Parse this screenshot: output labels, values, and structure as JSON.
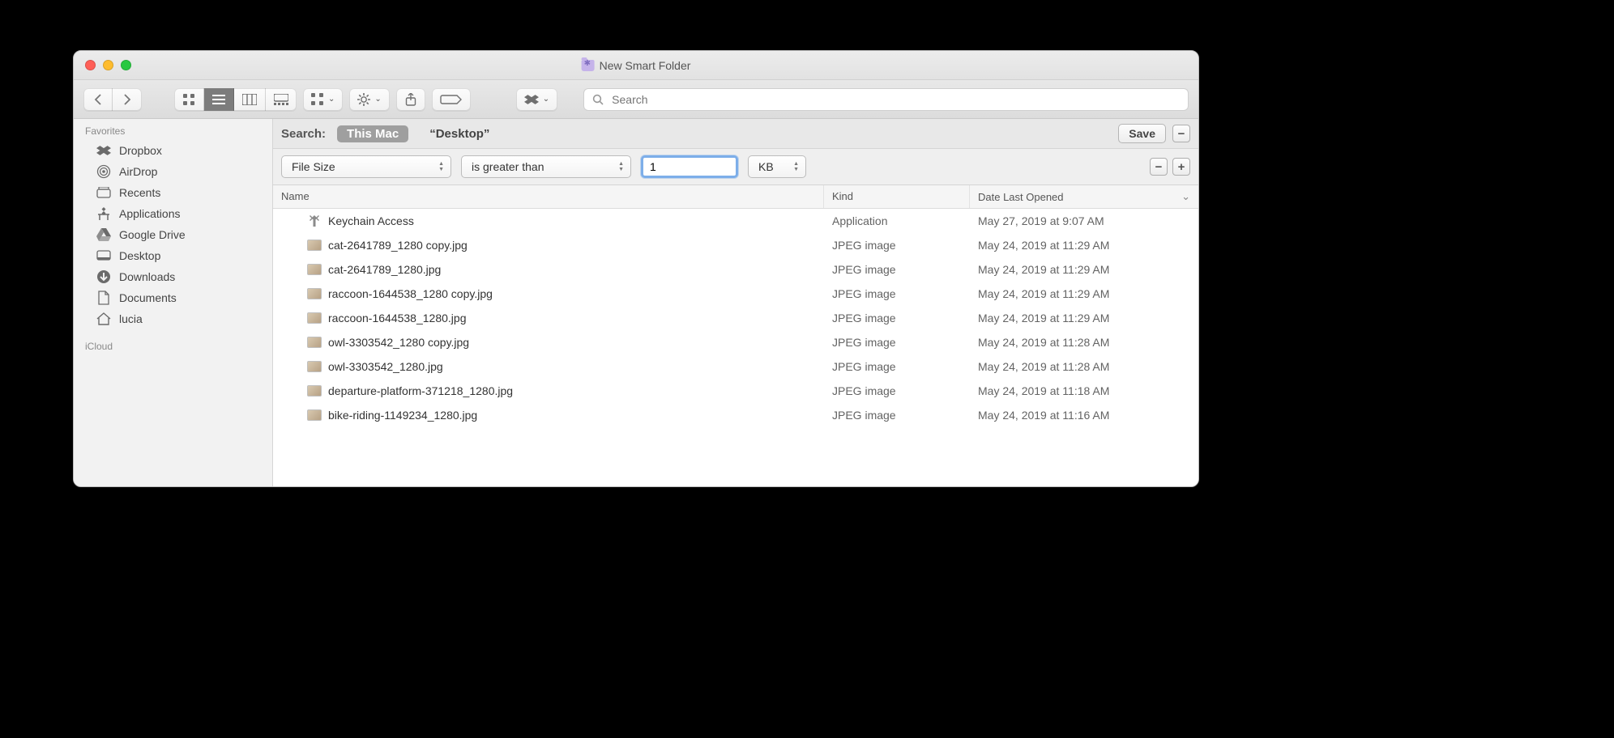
{
  "window": {
    "title": "New Smart Folder"
  },
  "toolbar": {
    "search_placeholder": "Search"
  },
  "sidebar": {
    "sections": [
      {
        "label": "Favorites",
        "items": [
          {
            "icon": "dropbox-icon",
            "label": "Dropbox"
          },
          {
            "icon": "airdrop-icon",
            "label": "AirDrop"
          },
          {
            "icon": "recents-icon",
            "label": "Recents"
          },
          {
            "icon": "applications-icon",
            "label": "Applications"
          },
          {
            "icon": "google-drive-icon",
            "label": "Google Drive"
          },
          {
            "icon": "desktop-icon",
            "label": "Desktop"
          },
          {
            "icon": "downloads-icon",
            "label": "Downloads"
          },
          {
            "icon": "documents-icon",
            "label": "Documents"
          },
          {
            "icon": "home-icon",
            "label": "lucia"
          }
        ]
      },
      {
        "label": "iCloud",
        "items": []
      }
    ]
  },
  "scope": {
    "label": "Search:",
    "options": [
      {
        "label": "This Mac",
        "selected": true
      },
      {
        "label": "“Desktop”",
        "selected": false
      }
    ],
    "save_label": "Save"
  },
  "criteria": {
    "attribute": "File Size",
    "comparison": "is greater than",
    "value": "1",
    "unit": "KB"
  },
  "table": {
    "columns": [
      {
        "label": "Name"
      },
      {
        "label": "Kind"
      },
      {
        "label": "Date Last Opened"
      }
    ],
    "rows": [
      {
        "icon": "app",
        "name": "Keychain Access",
        "kind": "Application",
        "date": "May 27, 2019 at 9:07 AM"
      },
      {
        "icon": "img",
        "name": "cat-2641789_1280 copy.jpg",
        "kind": "JPEG image",
        "date": "May 24, 2019 at 11:29 AM"
      },
      {
        "icon": "img",
        "name": "cat-2641789_1280.jpg",
        "kind": "JPEG image",
        "date": "May 24, 2019 at 11:29 AM"
      },
      {
        "icon": "img",
        "name": "raccoon-1644538_1280 copy.jpg",
        "kind": "JPEG image",
        "date": "May 24, 2019 at 11:29 AM"
      },
      {
        "icon": "img",
        "name": "raccoon-1644538_1280.jpg",
        "kind": "JPEG image",
        "date": "May 24, 2019 at 11:29 AM"
      },
      {
        "icon": "img",
        "name": "owl-3303542_1280 copy.jpg",
        "kind": "JPEG image",
        "date": "May 24, 2019 at 11:28 AM"
      },
      {
        "icon": "img",
        "name": "owl-3303542_1280.jpg",
        "kind": "JPEG image",
        "date": "May 24, 2019 at 11:28 AM"
      },
      {
        "icon": "img",
        "name": "departure-platform-371218_1280.jpg",
        "kind": "JPEG image",
        "date": "May 24, 2019 at 11:18 AM"
      },
      {
        "icon": "img",
        "name": "bike-riding-1149234_1280.jpg",
        "kind": "JPEG image",
        "date": "May 24, 2019 at 11:16 AM"
      }
    ]
  }
}
